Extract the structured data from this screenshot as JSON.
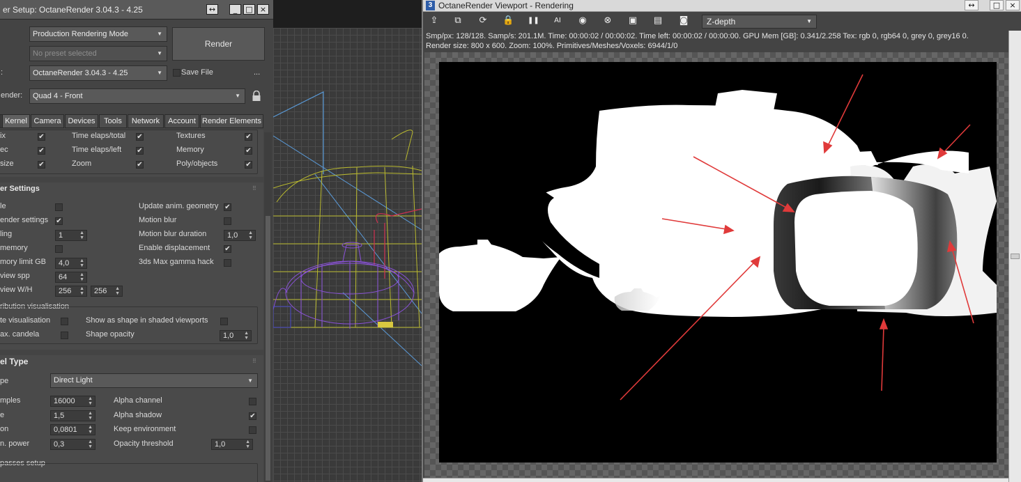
{
  "render_setup": {
    "title": "er Setup: OctaneRender 3.04.3 - 4.25",
    "window_buttons": [
      "↔",
      "_",
      "□",
      "×"
    ],
    "mode_dropdown": "Production Rendering Mode",
    "preset_dropdown": "No preset selected",
    "renderer_label": ":",
    "renderer_dropdown": "OctaneRender 3.04.3 - 4.25",
    "save_file_label": "Save File",
    "more_label": "...",
    "view_label": "ender:",
    "view_dropdown": "Quad 4 - Front",
    "render_button": "Render",
    "tabs": [
      "Kernel",
      "Camera",
      "Devices",
      "Tools",
      "Network",
      "Account",
      "Render Elements"
    ],
    "stats_rows": [
      {
        "a": "ix",
        "a_checked": true,
        "b": "Time elaps/total",
        "b_checked": true,
        "c": "Textures",
        "c_checked": true
      },
      {
        "a": "ec",
        "a_checked": true,
        "b": "Time elaps/left",
        "b_checked": true,
        "c": "Memory",
        "c_checked": true
      },
      {
        "a": " size",
        "a_checked": true,
        "b": "Zoom",
        "b_checked": true,
        "c": "Poly/objects",
        "c_checked": true
      }
    ],
    "settings_header": "er Settings",
    "settings_left": [
      {
        "label": "le",
        "type": "check",
        "checked": false
      },
      {
        "label": "ender settings",
        "type": "check",
        "checked": true
      },
      {
        "label": "ling",
        "type": "spin",
        "value": "1"
      },
      {
        "label": "memory",
        "type": "check",
        "checked": false
      },
      {
        "label": "mory limit GB",
        "type": "spin",
        "value": "4,0"
      },
      {
        "label": "view spp",
        "type": "spin",
        "value": "64"
      },
      {
        "label": "view W/H",
        "type": "spin2",
        "value": "256",
        "value2": "256"
      }
    ],
    "settings_right": [
      {
        "label": "Update anim. geometry",
        "type": "check",
        "checked": true
      },
      {
        "label": "Motion blur",
        "type": "check",
        "checked": false
      },
      {
        "label": "Motion blur duration",
        "type": "spin",
        "value": "1,0"
      },
      {
        "label": "Enable displacement",
        "type": "check",
        "checked": true
      },
      {
        "label": "3ds Max gamma hack",
        "type": "check",
        "checked": false
      }
    ],
    "distribution_header": "ribution visualisation",
    "distribution_rows": [
      {
        "a": "te visualisation",
        "a_checked": false,
        "b": "Show as shape in shaded viewports",
        "b_checked": false
      },
      {
        "a": "ax. candela",
        "a_checked": false,
        "b": "Shape opacity",
        "b_value": "1,0"
      }
    ],
    "kernel_header": "el Type",
    "kernel_type_label": "pe",
    "kernel_type_value": "Direct Light",
    "kernel_left": [
      {
        "label": "mples",
        "value": "16000"
      },
      {
        "label": "e",
        "value": "1,5"
      },
      {
        "label": "on",
        "value": "0,0801"
      },
      {
        "label": "n. power",
        "value": "0,3"
      }
    ],
    "kernel_right": [
      {
        "label": "Alpha channel",
        "type": "check",
        "checked": false
      },
      {
        "label": "Alpha shadow",
        "type": "check",
        "checked": true
      },
      {
        "label": "Keep environment",
        "type": "check",
        "checked": false
      },
      {
        "label": "Opacity threshold",
        "type": "spin",
        "value": "1,0"
      }
    ],
    "passes_header": "passes setup"
  },
  "octane_viewport": {
    "app_icon": "3",
    "title": "OctaneRender Viewport - Rendering",
    "window_buttons": [
      "↔",
      "□",
      "×"
    ],
    "toolbar_icons": [
      {
        "name": "send-scene-icon",
        "glyph": "⇪"
      },
      {
        "name": "copy-icon",
        "glyph": "⧉"
      },
      {
        "name": "restart-icon",
        "glyph": "⟳"
      },
      {
        "name": "lock-icon",
        "glyph": "🔒"
      },
      {
        "name": "pause-icon",
        "glyph": "❚❚"
      },
      {
        "name": "ai-light-icon",
        "glyph": "AI"
      },
      {
        "name": "color-picker-icon",
        "glyph": "◉"
      },
      {
        "name": "clear-icon",
        "glyph": "⊗"
      },
      {
        "name": "region-icon",
        "glyph": "▣"
      },
      {
        "name": "film-icon",
        "glyph": "▤"
      },
      {
        "name": "camera-icon",
        "glyph": "◙"
      }
    ],
    "pass_select": "Z-depth",
    "stats_line1": "Smp/px: 128/128.   Samp/s: 201.1M.   Time: 00:00:02 / 00:00:02.   Time left: 00:00:02 / 00:00:00.   GPU Mem [GB]: 0.341/2.258   Tex: rgb 0, rgb64 0, grey 0, grey16 0.",
    "stats_line2": "Render size: 800 x 600.   Zoom: 100%.   Primitives/Meshes/Voxels: 6944/1/0",
    "annotation_color": "#e03a3a"
  }
}
